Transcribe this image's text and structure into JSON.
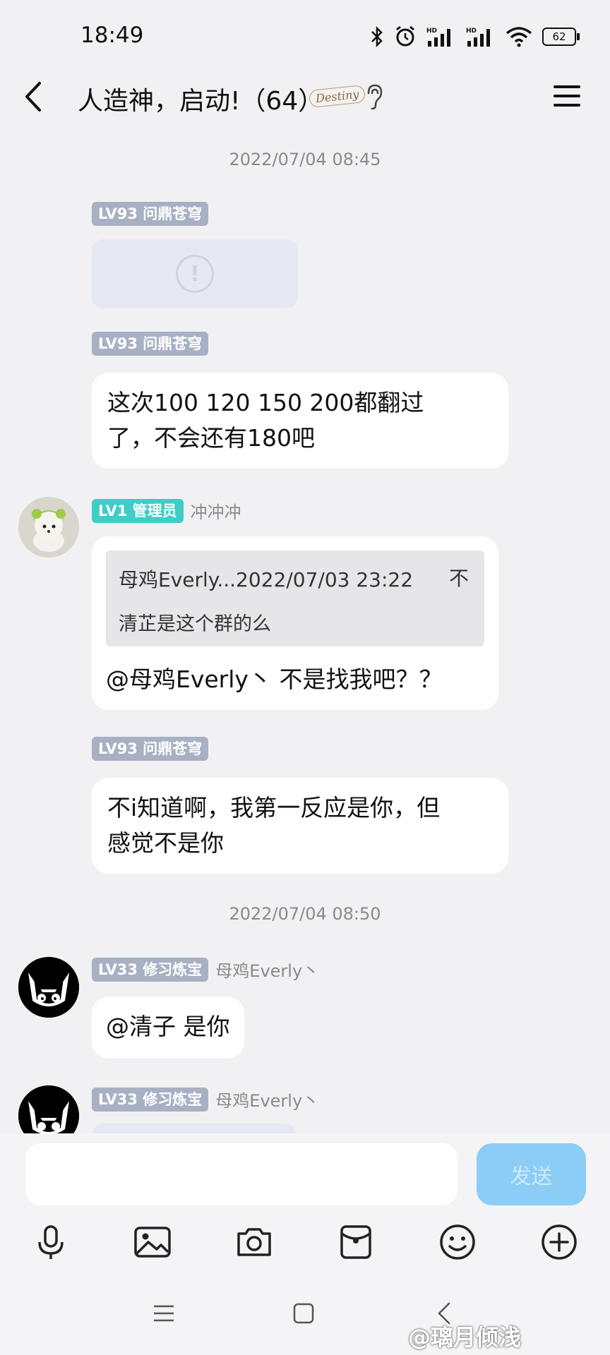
{
  "status_bar": {
    "time": "18:49",
    "battery": "62"
  },
  "header": {
    "title": "人造神，启动!（64）",
    "logo_text": "Destiny"
  },
  "messages": {
    "ts1": "2022/07/04 08:45",
    "m1": {
      "level": "LV93",
      "title": "问鼎苍穹"
    },
    "m2": {
      "level": "LV93",
      "title": "问鼎苍穹",
      "line1": "这次100  120  150  200都翻过",
      "line2": "了，不会还有180吧"
    },
    "m3": {
      "level": "LV1",
      "title": "管理员",
      "nick": "冲冲冲",
      "quote_head": "母鸡Everly...2022/07/03 23:22",
      "quote_mark": "不",
      "quote_body": "清芷是这个群的么",
      "text": "@母鸡Everly丶 不是找我吧？？"
    },
    "m4": {
      "level": "LV93",
      "title": "问鼎苍穹",
      "line1": "不i知道啊，我第一反应是你，但",
      "line2": "感觉不是你"
    },
    "ts2": "2022/07/04 08:50",
    "m5": {
      "level": "LV33",
      "title": "修习炼宝",
      "nick": "母鸡Everly丶",
      "text": "@清子 是你"
    },
    "m6": {
      "level": "LV33",
      "title": "修习炼宝",
      "nick": "母鸡Everly丶"
    }
  },
  "input": {
    "send_label": "发送"
  },
  "watermark": "@璃月倾浅",
  "colors": {
    "admin_badge": "#3ecdc7",
    "level_badge": "#a8b0c4",
    "send_button": "#8bcdf4"
  }
}
